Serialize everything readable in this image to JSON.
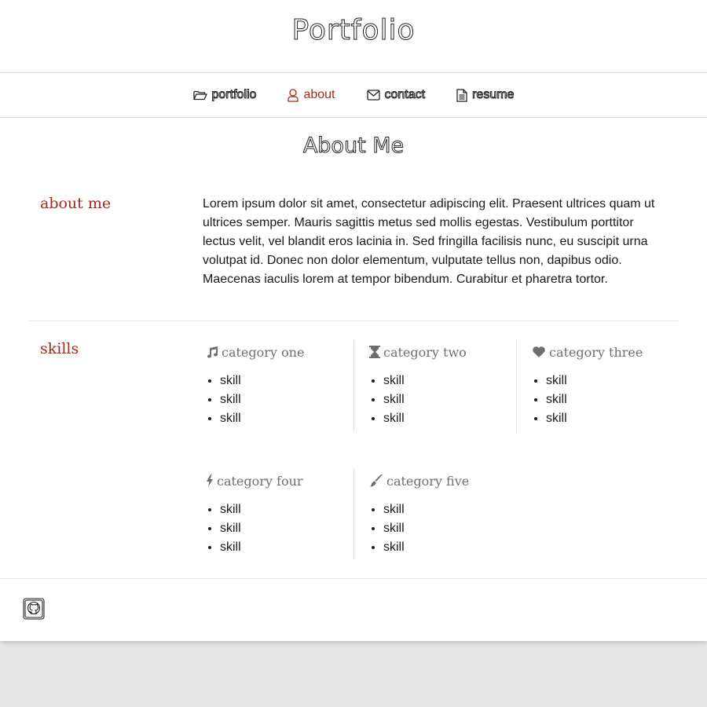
{
  "site": {
    "title": "Portfolio"
  },
  "nav": {
    "items": [
      {
        "label": "portfolio",
        "icon": "folder-open-icon"
      },
      {
        "label": "about",
        "icon": "user-icon",
        "active": true
      },
      {
        "label": "contact",
        "icon": "envelope-icon"
      },
      {
        "label": "resume",
        "icon": "file-text-icon"
      }
    ],
    "active_color": "#a52a1a"
  },
  "page": {
    "heading": "About Me"
  },
  "about": {
    "label": "about me",
    "text": "Lorem ipsum dolor sit amet, consectetur adipiscing elit. Praesent ultrices quam ut ultrices semper. Mauris sagittis metus sed mollis egestas. Vestibulum porttitor lectus velit, vel blandit eros lacinia in. Sed fringilla facilisis nunc, eu suscipit urna volutpat id. Donec non dolor elementum, vulputate tellus non, dapibus odio. Maecenas iaculis lorem at tempor bibendum. Curabitur et pharetra tortor."
  },
  "skills": {
    "label": "skills",
    "categories": [
      {
        "name": "category one",
        "icon": "music-icon",
        "items": [
          "skill",
          "skill",
          "skill"
        ]
      },
      {
        "name": "category two",
        "icon": "hourglass-icon",
        "items": [
          "skill",
          "skill",
          "skill"
        ]
      },
      {
        "name": "category three",
        "icon": "heart-icon",
        "items": [
          "skill",
          "skill",
          "skill"
        ]
      },
      {
        "name": "category four",
        "icon": "bolt-icon",
        "items": [
          "skill",
          "skill",
          "skill"
        ]
      },
      {
        "name": "category five",
        "icon": "paint-brush-icon",
        "items": [
          "skill",
          "skill",
          "skill"
        ]
      }
    ]
  },
  "footer": {
    "icon": "github-icon"
  }
}
